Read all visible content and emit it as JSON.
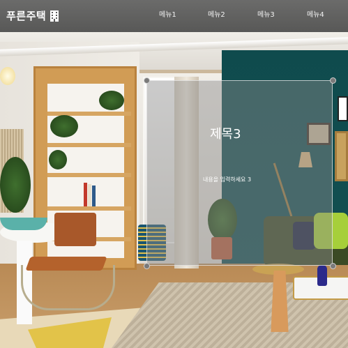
{
  "header": {
    "brand": "푸른주택",
    "brand_icon": "building-icon",
    "menu": [
      {
        "label": "메뉴1"
      },
      {
        "label": "메뉴2"
      },
      {
        "label": "메뉴3"
      },
      {
        "label": "메뉴4"
      }
    ]
  },
  "card": {
    "title": "제목3",
    "body": "내용을 입력하세요 3"
  },
  "colors": {
    "header_bg": "#626261",
    "card_bg": "rgba(140,140,140,0.45)",
    "teal_wall": "#124d50"
  }
}
